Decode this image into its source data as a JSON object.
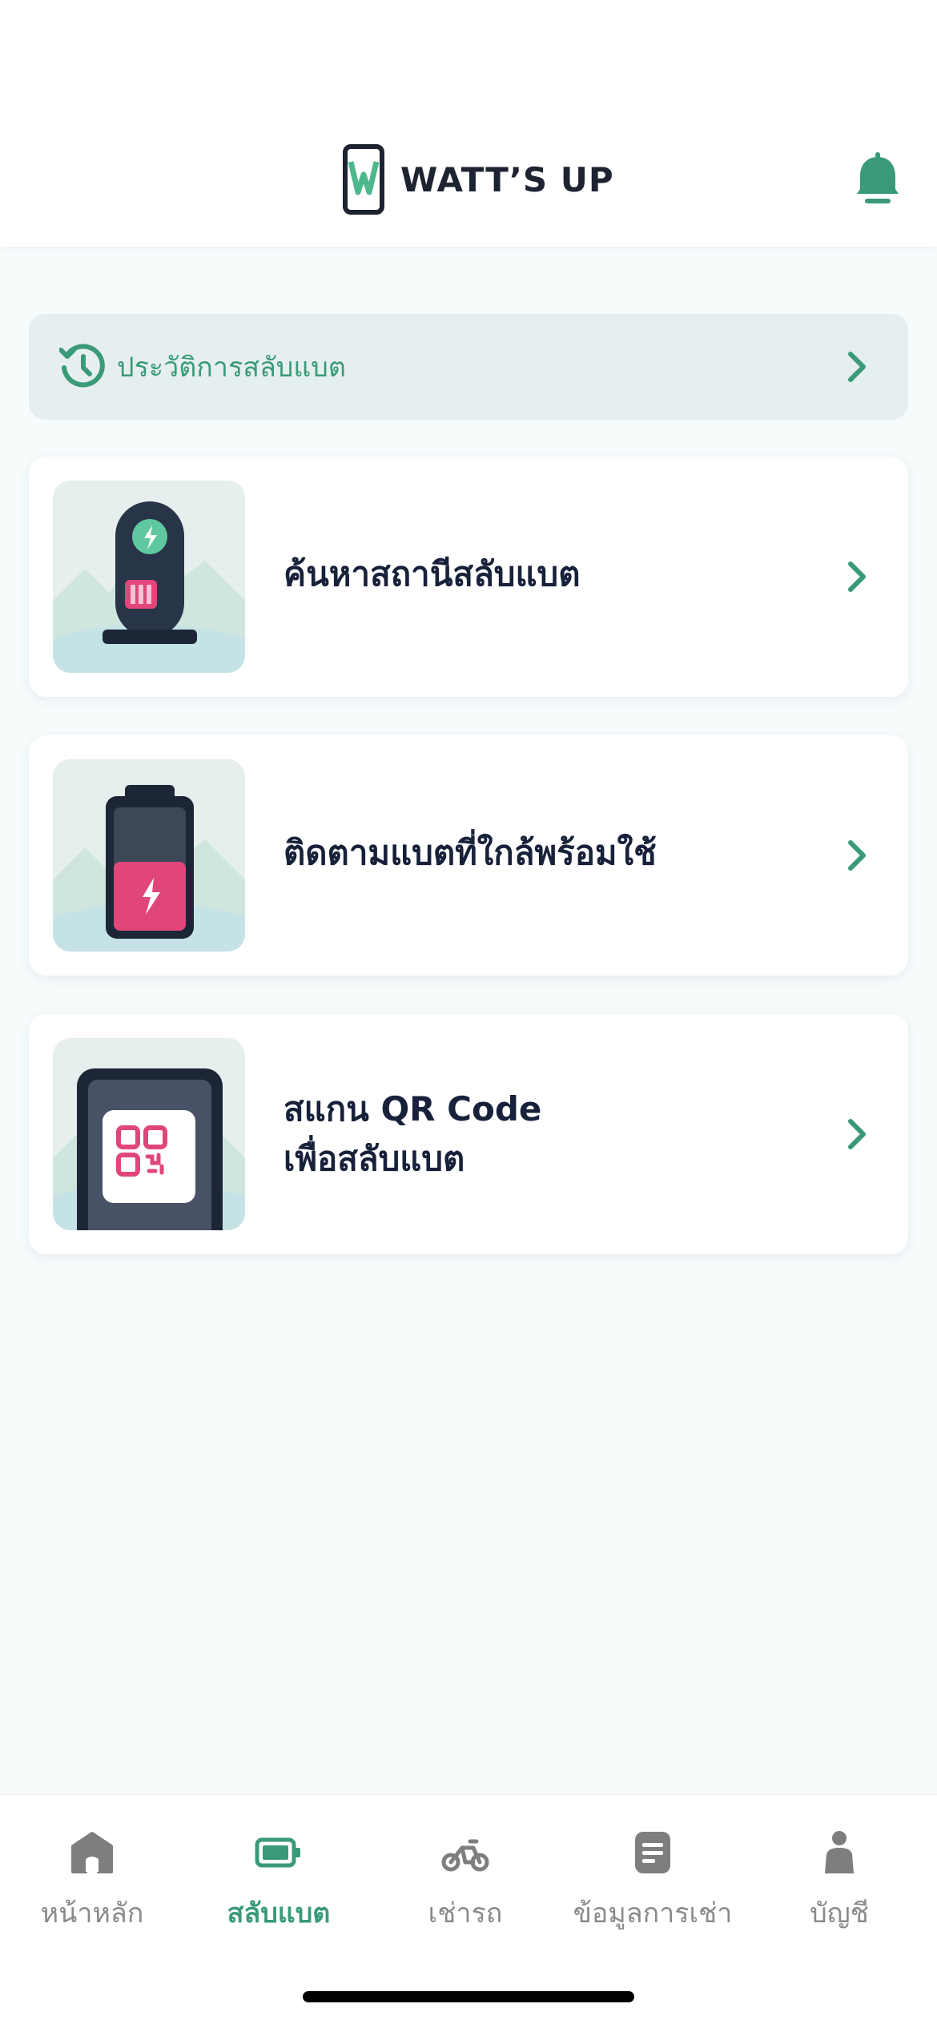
{
  "header": {
    "brand": "WATT’S UP",
    "icons": [
      "logo-mark",
      "bell-icon"
    ]
  },
  "history": {
    "label": "ประวัติการสลับแบต",
    "icon": "history-icon"
  },
  "cards": [
    {
      "title_line1": "ค้นหาสถานีสลับแบต",
      "title_line2": "",
      "icon": "station-illustration"
    },
    {
      "title_line1": "ติดตามแบตที่ใกล้พร้อมใช้",
      "title_line2": "",
      "icon": "battery-illustration"
    },
    {
      "title_line1": "สแกน QR Code",
      "title_line2": "เพื่อสลับแบต",
      "icon": "qr-illustration"
    }
  ],
  "nav": {
    "items": [
      {
        "label": "หน้าหลัก",
        "icon": "home-icon",
        "active": false
      },
      {
        "label": "สลับแบต",
        "icon": "battery-icon",
        "active": true
      },
      {
        "label": "เช่ารถ",
        "icon": "scooter-icon",
        "active": false
      },
      {
        "label": "ข้อมูลการเช่า",
        "icon": "document-icon",
        "active": false
      },
      {
        "label": "บัญชี",
        "icon": "person-icon",
        "active": false
      }
    ]
  },
  "colors": {
    "accent": "#3a9a78",
    "navy": "#17213a",
    "background": "#f6fbfc",
    "history_bg": "#e6eff0"
  }
}
